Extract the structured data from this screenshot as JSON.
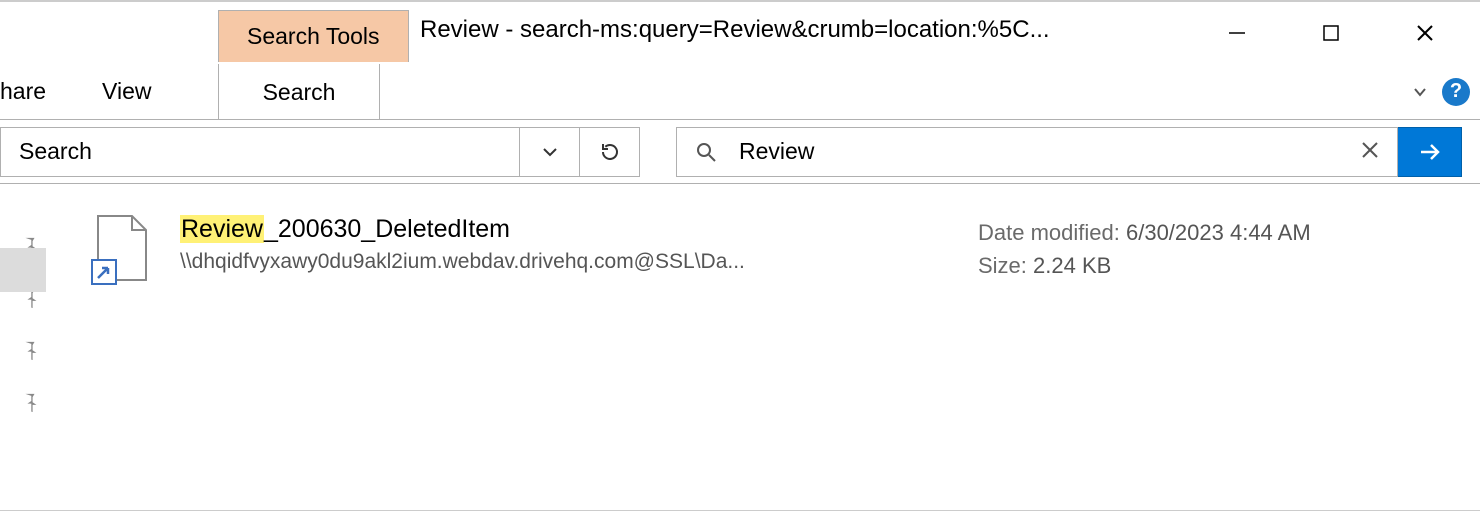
{
  "titlebar": {
    "tools_tab": "Search Tools",
    "window_title": "Review - search-ms:query=Review&crumb=location:%5C..."
  },
  "ribbon": {
    "share_label": "hare",
    "view_label": "View",
    "search_label": "Search"
  },
  "address": {
    "text": "Search"
  },
  "search": {
    "value": "Review"
  },
  "result": {
    "name_highlight": "Review",
    "name_rest": "_200630_DeletedItem",
    "path": "\\\\dhqidfvyxawy0du9akl2ium.webdav.drivehq.com@SSL\\Da...",
    "date_label": "Date modified:",
    "date_value": "6/30/2023 4:44 AM",
    "size_label": "Size:",
    "size_value": "2.24 KB"
  },
  "help_glyph": "?"
}
